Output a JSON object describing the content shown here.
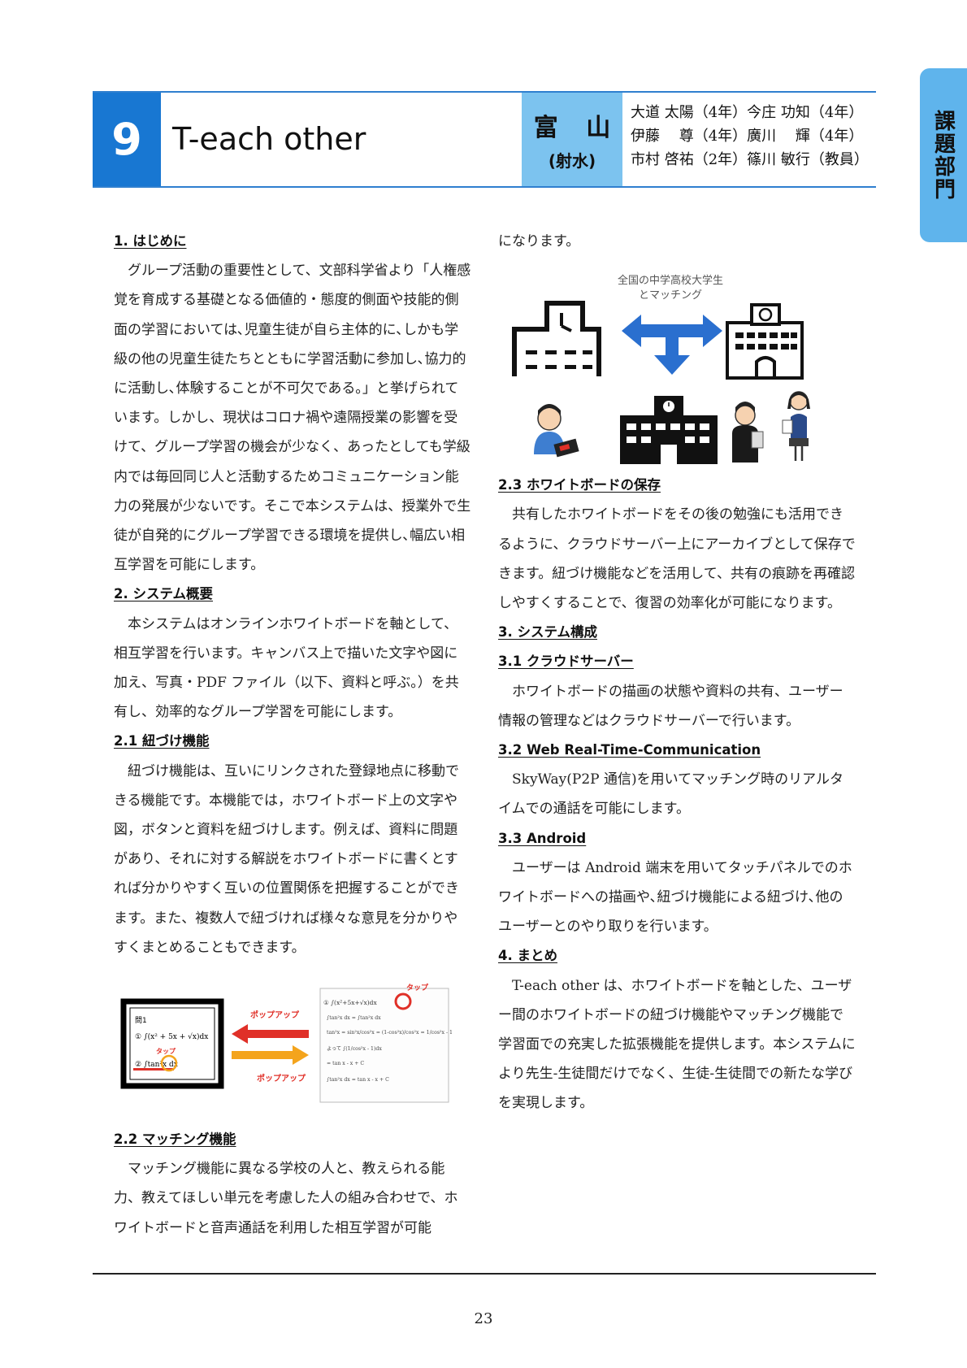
{
  "side_tab": "課題部門",
  "header": {
    "number": "9",
    "title": "T-each other",
    "prefecture": "富 山",
    "school": "(射水)",
    "authors": [
      "大道 太陽（4年）今庄 功知（4年）",
      "伊藤　 尊（4年）廣川　 輝（4年）",
      "市村 啓祐（2年）篠川 敏行（教員）"
    ]
  },
  "left": {
    "h1": "1. はじめに",
    "p1": "グループ活動の重要性として、文部科学省より「人権感覚を育成する基礎となる価値的・態度的側面や技能的側面の学習においては､児童生徒が自ら主体的に､しかも学級の他の児童生徒たちとともに学習活動に参加し､協力的に活動し､体験することが不可欠である｡」と挙げられています。しかし、現状はコロナ禍や遠隔授業の影響を受けて、グループ学習の機会が少なく、あったとしても学級内では毎回同じ人と活動するためコミュニケーション能力の発展が少ないです。そこで本システムは、授業外で生徒が自発的にグループ学習できる環境を提供し､幅広い相互学習を可能にします。",
    "h2": "2. システム概要",
    "p2": "本システムはオンラインホワイトボードを軸として、相互学習を行います。キャンバス上で描いた文字や図に加え、写真・PDF ファイル（以下、資料と呼ぶ。）を共有し、効率的なグループ学習を可能にします。",
    "h21": "2.1 紐づけ機能",
    "p21": "紐づけ機能は、互いにリンクされた登録地点に移動できる機能です。本機能では，ホワイトボード上の文字や図，ボタンと資料を紐づけします。例えば、資料に問題があり、それに対する解説をホワイトボードに書くとすれば分かりやすく互いの位置関係を把握することができます。また、複数人で紐づければ様々な意見を分かりやすくまとめることもできます。",
    "fig1": {
      "q_title": "問1",
      "q1": "① ∫(x² + 5x + √x)dx",
      "q2": "② ∫tan²x dx",
      "tap_left": "タップ",
      "popup_top": "ポップアップ",
      "popup_bottom": "ポップアップ",
      "tap_right": "タップ",
      "note_title": "① ∫(x²+5x+√x)dx",
      "note_lines": [
        "∫tan²x dx = ∫tan²x dx",
        "tan²x = sin²x/cos²x = (1-cos²x)/cos²x = 1/cos²x - 1",
        "よって ∫(1/cos²x - 1)dx",
        "= tan x - x + C",
        "∫tan²x dx = tan x - x + C"
      ]
    },
    "h22": "2.2 マッチング機能",
    "p22": "マッチング機能に異なる学校の人と、教えられる能力、教えてほしい単元を考慮した人の組み合わせで、ホワイトボードと音声通話を利用した相互学習が可能"
  },
  "right": {
    "p_cont": "になります。",
    "fig2": {
      "caption_line1": "全国の中学高校大学生",
      "caption_line2": "とマッチング"
    },
    "h23": "2.3 ホワイトボードの保存",
    "p23": "共有したホワイトボードをその後の勉強にも活用できるように、クラウドサーバー上にアーカイブとして保存できます。紐づけ機能などを活用して、共有の痕跡を再確認しやすくすることで、復習の効率化が可能になります。",
    "h3": "3. システム構成",
    "h31": "3.1 クラウドサーバー",
    "p31": "ホワイトボードの描画の状態や資料の共有、ユーザー情報の管理などはクラウドサーバーで行います。",
    "h32": "3.2 Web Real-Time-Communication",
    "p32": "SkyWay(P2P 通信)を用いてマッチング時のリアルタイムでの通話を可能にします。",
    "h33": "3.3 Android",
    "p33": "ユーザーは Android 端末を用いてタッチパネルでのホワイトボードへの描画や､紐づけ機能による紐づけ､他のユーザーとのやり取りを行います。",
    "h4": "4. まとめ",
    "p4": "T-each other は、ホワイトボードを軸とした、ユーザー間のホワイトボードの紐づけ機能やマッチング機能で学習面での充実した拡張機能を提供します。本システムにより先生-生徒間だけでなく、生徒-生徒間での新たな学びを実現します。"
  },
  "page_number": "23",
  "colors": {
    "number_box": "#1877d2",
    "pref_box": "#7cc3ef",
    "side_tab": "#5fb4ec",
    "header_rule": "#2f7fcf",
    "arrow_red": "#e03028",
    "arrow_orange": "#f4a41c",
    "arrow_blue": "#2a6fcf"
  }
}
